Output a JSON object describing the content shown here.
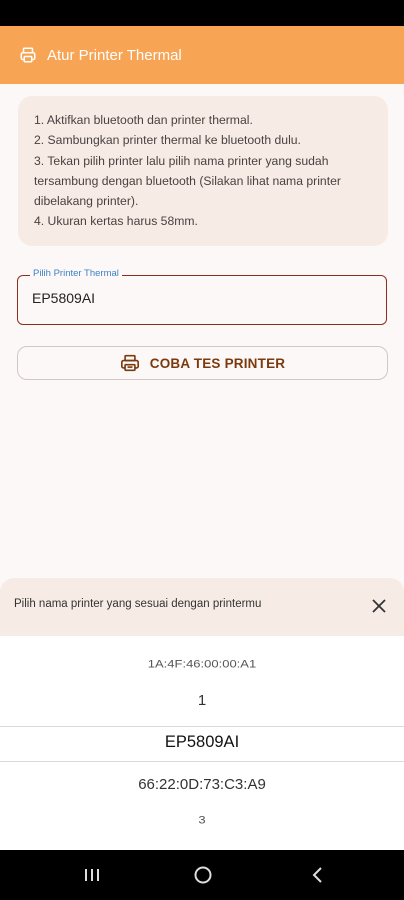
{
  "app_bar": {
    "title": "Atur Printer Thermal",
    "icon": "printer-icon",
    "color": "#f7a454"
  },
  "instructions": [
    "1. Aktifkan bluetooth dan printer thermal.",
    "2. Sambungkan printer thermal ke bluetooth dulu.",
    "3. Tekan pilih printer lalu pilih nama printer yang sudah",
    "tersambung dengan bluetooth (Silakan lihat nama printer",
    "dibelakang printer).",
    "4. Ukuran kertas harus 58mm."
  ],
  "printer_field": {
    "label": "Pilih Printer Thermal",
    "value": "EP5809AI"
  },
  "test_button": {
    "label": "COBA TES PRINTER",
    "icon": "printer-icon"
  },
  "sheet": {
    "title": "Pilih nama printer yang sesuai dengan printermu",
    "close_icon": "close-icon",
    "options": [
      "1A:4F:46:00:00:A1",
      "1",
      "EP5809AI",
      "66:22:0D:73:C3:A9",
      "3"
    ],
    "selected": "EP5809AI"
  },
  "nav_bar": {
    "buttons": [
      "recents-icon",
      "home-icon",
      "back-icon"
    ]
  }
}
